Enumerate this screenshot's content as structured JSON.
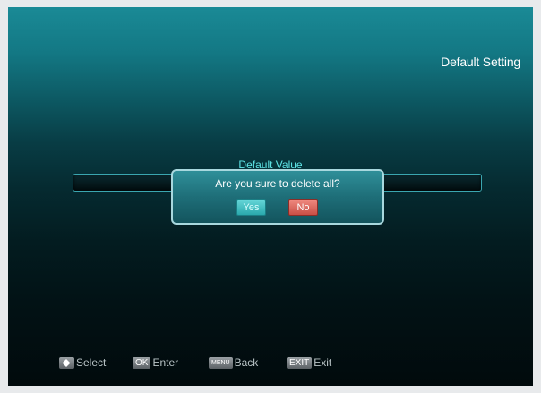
{
  "screen": {
    "title": "Default Setting"
  },
  "field": {
    "label": "Default Value"
  },
  "dialog": {
    "message": "Are you sure to delete all?",
    "yes_label": "Yes",
    "no_label": "No",
    "selected": "No"
  },
  "footer": {
    "hints": [
      {
        "key_icon": "up-down-arrows-icon",
        "label": "Select"
      },
      {
        "key": "OK",
        "label": "Enter"
      },
      {
        "key": "MENU",
        "label": "Back"
      },
      {
        "key": "EXIT",
        "label": "Exit"
      }
    ]
  },
  "colors": {
    "accent": "#5fe6e8",
    "yes_button": "#2aa9ad",
    "no_button": "#c84f46",
    "dialog_border": "#a8d8de"
  }
}
